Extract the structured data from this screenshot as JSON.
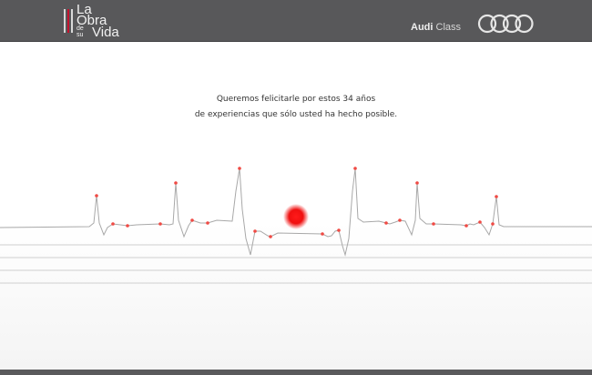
{
  "header": {
    "logo": {
      "line1": "La",
      "line2": "Obra",
      "line3": "de",
      "line4": "su",
      "line5": "Vida"
    },
    "brand_link": {
      "bold": "Audi",
      "rest": " Class"
    },
    "rings_icon": "audi-rings-icon",
    "background_color": "#58585a"
  },
  "main": {
    "message_line1": "Queremos felicitarle por estos 34 años",
    "message_line2": "de experiencias que sólo usted ha hecho posible."
  },
  "colors": {
    "accent": "#e8161c",
    "waveform": "#a8a8a8",
    "marker": "#f04a44",
    "footer": "#5a5a5c"
  }
}
